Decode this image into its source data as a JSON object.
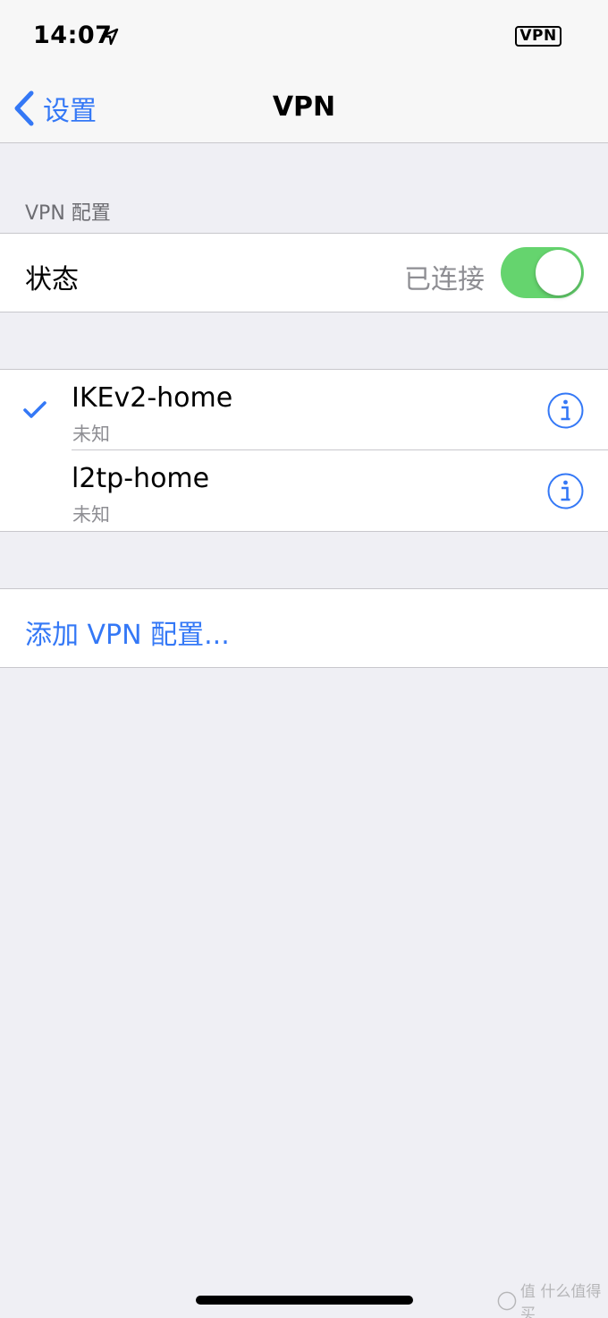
{
  "status_bar": {
    "time": "14:07",
    "location_icon": "location-arrow-icon",
    "vpn_badge": "VPN"
  },
  "nav": {
    "back_label": "设置",
    "title": "VPN",
    "back_icon": "chevron-left-icon"
  },
  "section": {
    "header": "VPN 配置"
  },
  "status_row": {
    "label": "状态",
    "value": "已连接",
    "toggle_on": true
  },
  "profiles": [
    {
      "name": "IKEv2-home",
      "status": "未知",
      "selected": true
    },
    {
      "name": "l2tp-home",
      "status": "未知",
      "selected": false
    }
  ],
  "add_label": "添加 VPN 配置...",
  "watermark": "值 什么值得买",
  "colors": {
    "accent": "#3478f6",
    "toggle_on": "#65d46e",
    "background": "#efeff4",
    "secondary_text": "#8e8e93"
  }
}
